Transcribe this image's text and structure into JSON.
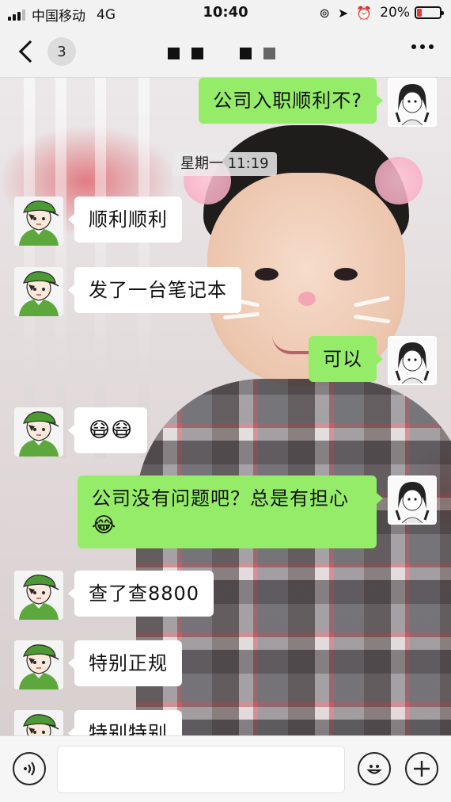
{
  "status_bar": {
    "carrier": "中国移动",
    "network": "4G",
    "time": "10:40",
    "battery_percent": "20%",
    "battery_level": 0.2,
    "icons": [
      "signal-icon",
      "rotation-lock-icon",
      "location-icon",
      "alarm-icon",
      "battery-icon"
    ]
  },
  "nav": {
    "back_count": "3",
    "title_redacted": true,
    "icons": [
      "chevron-left-icon",
      "more-icon"
    ]
  },
  "chat": {
    "time_divider": "星期一 11:19",
    "messages": [
      {
        "side": "right",
        "text": "公司入职顺利不?"
      },
      {
        "side": "left",
        "text": "顺利顺利"
      },
      {
        "side": "left",
        "text": "发了一台笔记本"
      },
      {
        "side": "right",
        "text": "可以"
      },
      {
        "side": "left",
        "text": "😷😷"
      },
      {
        "side": "right",
        "text": "公司没有问题吧？总是有担心",
        "text2": "😂"
      },
      {
        "side": "left",
        "text": "查了查8800"
      },
      {
        "side": "left",
        "text": "特别正规"
      },
      {
        "side": "left",
        "text": "特别特别"
      }
    ]
  },
  "input_bar": {
    "text_value": "",
    "icons": [
      "voice-icon",
      "emoji-icon",
      "add-icon"
    ]
  },
  "colors": {
    "sent_bubble": "#95ec69",
    "received_bubble": "#ffffff",
    "battery_low": "#e53935"
  }
}
